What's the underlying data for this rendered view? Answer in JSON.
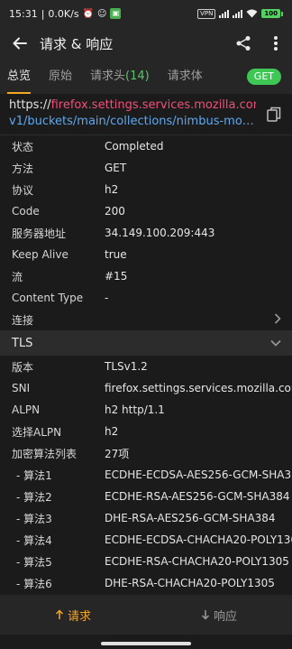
{
  "status_bar": {
    "time": "15:31",
    "speed": "0.0K/s",
    "vpn": "VPN",
    "battery": "100"
  },
  "header": {
    "title": "请求 & 响应"
  },
  "tabs": [
    {
      "label": "总览",
      "active": true
    },
    {
      "label": "原始",
      "active": false
    },
    {
      "label": "请求头",
      "count": "(14)",
      "active": false
    },
    {
      "label": "请求体",
      "active": false
    }
  ],
  "method_badge": "GET",
  "url": {
    "scheme": "https://",
    "host": "firefox.settings.services.mozilla.com",
    "slash": "/",
    "path_line2": "v1/buckets/main/collections/nimbus-mobil..."
  },
  "overview": [
    {
      "key": "状态",
      "value": "Completed"
    },
    {
      "key": "方法",
      "value": "GET"
    },
    {
      "key": "协议",
      "value": "h2"
    },
    {
      "key": "Code",
      "value": "200"
    },
    {
      "key": "服务器地址",
      "value": "34.149.100.209:443"
    },
    {
      "key": "Keep Alive",
      "value": "true"
    },
    {
      "key": "流",
      "value": "#15"
    },
    {
      "key": "Content Type",
      "value": "-"
    }
  ],
  "connection_label": "连接",
  "tls": {
    "title": "TLS",
    "rows": [
      {
        "key": "版本",
        "value": "TLSv1.2"
      },
      {
        "key": "SNI",
        "value": "firefox.settings.services.mozilla.com"
      },
      {
        "key": "ALPN",
        "value": "h2 http/1.1"
      },
      {
        "key": "选择ALPN",
        "value": "h2"
      },
      {
        "key": "加密算法列表",
        "value": "27项"
      }
    ],
    "ciphers": [
      {
        "key": "- 算法1",
        "value": "ECDHE-ECDSA-AES256-GCM-SHA384"
      },
      {
        "key": "- 算法2",
        "value": "ECDHE-RSA-AES256-GCM-SHA384"
      },
      {
        "key": "- 算法3",
        "value": "DHE-RSA-AES256-GCM-SHA384"
      },
      {
        "key": "- 算法4",
        "value": "ECDHE-ECDSA-CHACHA20-POLY1305"
      },
      {
        "key": "- 算法5",
        "value": "ECDHE-RSA-CHACHA20-POLY1305"
      },
      {
        "key": "- 算法6",
        "value": "DHE-RSA-CHACHA20-POLY1305"
      }
    ]
  },
  "bottom_bar": {
    "request_label": "请求",
    "response_label": "响应"
  },
  "colors": {
    "accent": "#f5a623",
    "get_badge": "#3ec755",
    "url_host": "#f0507a",
    "url_path": "#5ea8f0",
    "count": "#5cc46a"
  },
  "icons": [
    "back-arrow-icon",
    "share-icon",
    "more-vert-icon",
    "copy-icon",
    "chevron-right-icon",
    "chevron-down-icon",
    "arrow-up-icon",
    "arrow-down-icon"
  ]
}
